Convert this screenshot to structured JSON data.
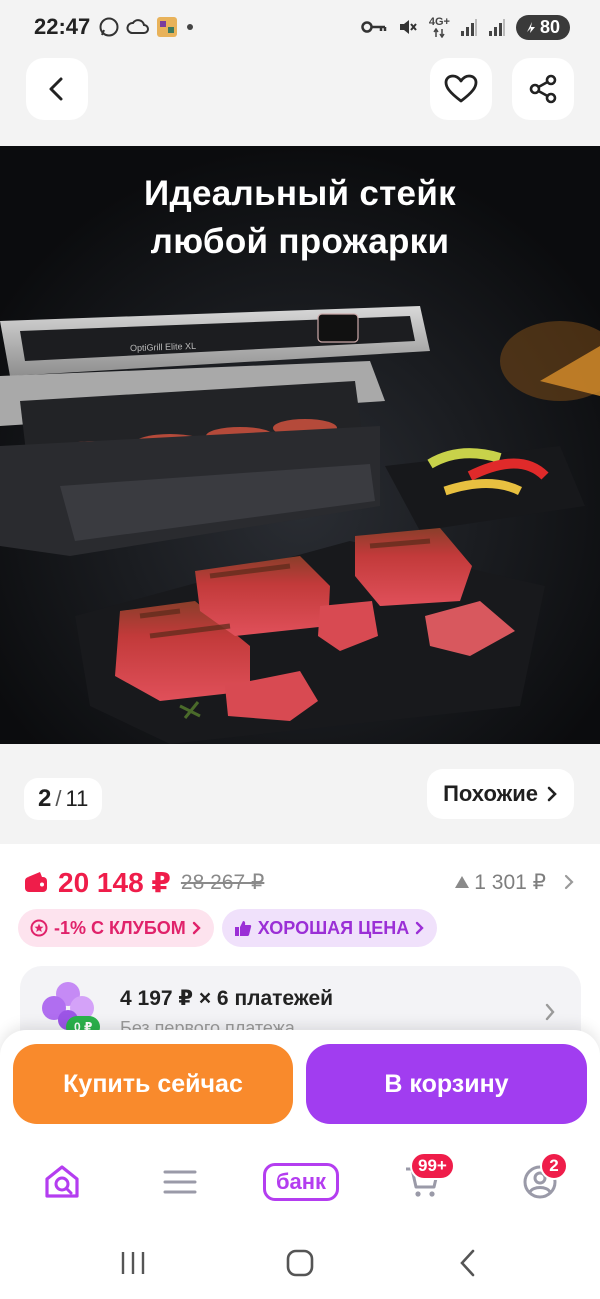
{
  "status_bar": {
    "time": "22:47",
    "network": "4G+",
    "battery": "80",
    "icons": [
      "whatsapp-icon",
      "cloud-icon",
      "app-thumb-icon",
      "dot-icon",
      "key-icon",
      "mute-icon",
      "signal-icon",
      "signal-icon",
      "battery-icon"
    ]
  },
  "header": {
    "icons": [
      "back-arrow-icon",
      "heart-icon",
      "share-icon"
    ]
  },
  "hero": {
    "title_line1": "Идеальный стейк",
    "title_line2": "любой прожарки",
    "product_text": "OptiGrill Elite XL"
  },
  "gallery": {
    "current": "2",
    "separator": "/",
    "total": "11",
    "similar_label": "Похожие"
  },
  "price": {
    "current": "20 148 ₽",
    "old": "28 267 ₽",
    "delta": "1 301 ₽",
    "badges": [
      {
        "label": "-1% С КЛУБОМ"
      },
      {
        "label": "ХОРОШАЯ ЦЕНА"
      }
    ]
  },
  "installments": {
    "main": "4 197 ₽ × 6 платежей",
    "sub": "Без первого платежа",
    "chip": "0 ₽"
  },
  "actions": {
    "buy_now": "Купить сейчас",
    "add_to_cart": "В корзину"
  },
  "bottom_nav": {
    "bank_label": "банк",
    "cart_badge": "99+",
    "profile_badge": "2"
  },
  "colors": {
    "price_red": "#ef1d4a",
    "buy_orange": "#f98a2c",
    "cart_purple": "#a13df0",
    "brand_purple": "#b43df0"
  }
}
